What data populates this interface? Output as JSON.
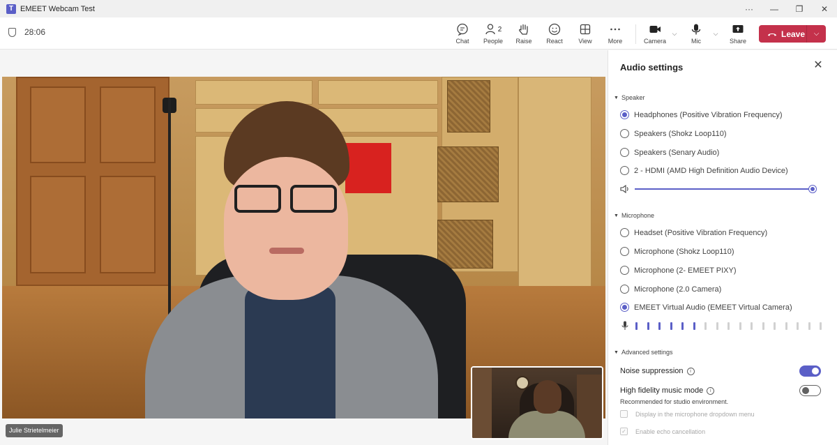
{
  "window": {
    "title": "EMEET Webcam Test",
    "app_icon": "T",
    "more_glyph": "···",
    "minimize_glyph": "—",
    "restore_glyph": "❐",
    "close_glyph": "✕"
  },
  "toolbar": {
    "timer": "28:06",
    "buttons": {
      "chat": "Chat",
      "people": "People",
      "people_count": "2",
      "raise": "Raise",
      "react": "React",
      "view": "View",
      "more": "More",
      "camera": "Camera",
      "mic": "Mic",
      "share": "Share"
    },
    "chevron_glyph": "⌵",
    "leave_label": "Leave",
    "leave_color": "#c4314b"
  },
  "stage": {
    "main_participant": "Julie Strietelmeier"
  },
  "audio_settings": {
    "title": "Audio settings",
    "close_glyph": "✕",
    "caret_glyph": "▼",
    "speaker": {
      "heading": "Speaker",
      "options": [
        {
          "label": "Headphones (Positive Vibration Frequency)",
          "selected": true
        },
        {
          "label": "Speakers (Shokz Loop110)",
          "selected": false
        },
        {
          "label": "Speakers (Senary Audio)",
          "selected": false
        },
        {
          "label": "2 - HDMI (AMD High Definition Audio Device)",
          "selected": false
        }
      ],
      "volume_fraction": 1.0
    },
    "microphone": {
      "heading": "Microphone",
      "options": [
        {
          "label": "Headset (Positive Vibration Frequency)",
          "selected": false
        },
        {
          "label": "Microphone (Shokz Loop110)",
          "selected": false
        },
        {
          "label": "Microphone (2- EMEET PIXY)",
          "selected": false
        },
        {
          "label": "Microphone (2.0 Camera)",
          "selected": false
        },
        {
          "label": "EMEET Virtual Audio (EMEET Virtual Camera)",
          "selected": true
        }
      ],
      "meter_segments_total": 17,
      "meter_segments_active": 6
    },
    "advanced": {
      "heading": "Advanced settings",
      "noise_suppression_label": "Noise suppression",
      "noise_suppression_on": true,
      "hifi_label": "High fidelity music mode",
      "hifi_on": false,
      "hifi_note": "Recommended for studio environment.",
      "info_glyph": "i",
      "check_glyph": "✓",
      "display_in_dropdown_label": "Display in the microphone dropdown menu",
      "display_in_dropdown_checked": false,
      "echo_cancel_label": "Enable echo cancellation",
      "echo_cancel_checked": true
    }
  },
  "colors": {
    "accent": "#5b5fc7",
    "leave_red": "#c4314b",
    "meter_inactive": "#d1d1d1"
  }
}
